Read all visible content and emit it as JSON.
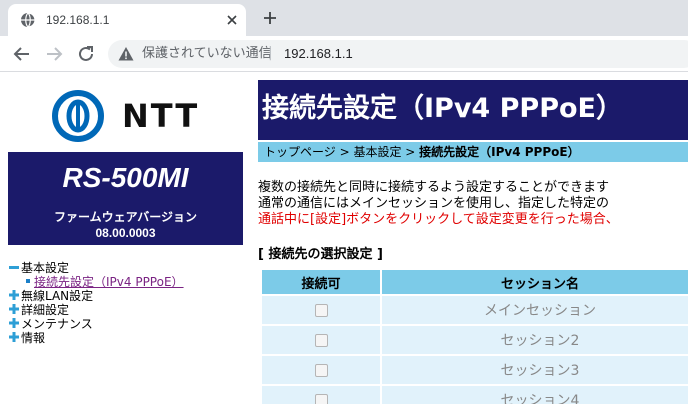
{
  "browser": {
    "tab_title": "192.168.1.1",
    "security_text": "保護されていない通信",
    "separator": "|",
    "url": "192.168.1.1"
  },
  "sidebar": {
    "logo_text": "NTT",
    "model": "RS-500MI",
    "firmware_label": "ファームウェアバージョン",
    "firmware_version": "08.00.0003",
    "menu": [
      {
        "label": "基本設定",
        "icon": "minus-icon"
      },
      {
        "label": "接続先設定（IPv4 PPPoE）",
        "icon": "bullet-icon"
      },
      {
        "label": "無線LAN設定",
        "icon": "plus-icon"
      },
      {
        "label": "詳細設定",
        "icon": "plus-icon"
      },
      {
        "label": "メンテナンス",
        "icon": "plus-icon"
      },
      {
        "label": "情報",
        "icon": "plus-icon"
      }
    ]
  },
  "main": {
    "title": "接続先設定（IPv4 PPPoE）",
    "breadcrumb": {
      "home": "トップページ",
      "sep": " > ",
      "parent": "基本設定",
      "current": "接続先設定（IPv4 PPPoE）"
    },
    "description": [
      "複数の接続先と同時に接続するよう設定することができます",
      "通常の通信にはメインセッションを使用し、指定した特定の",
      "通話中に[設定]ボタンをクリックして設定変更を行った場合、"
    ],
    "section_label": "[ 接続先の選択設定 ]",
    "table": {
      "headers": [
        "接続可",
        "セッション名"
      ],
      "rows": [
        {
          "enabled": false,
          "name": "メインセッション"
        },
        {
          "enabled": false,
          "name": "セッション2"
        },
        {
          "enabled": false,
          "name": "セッション3"
        },
        {
          "enabled": false,
          "name": "セッション4"
        }
      ]
    }
  },
  "colors": {
    "navy": "#1b1a6a",
    "cyan": "#7ccbe8",
    "light_cyan": "#e1f2fb",
    "warning_red": "#e00000",
    "link_purple": "#7a2383"
  }
}
